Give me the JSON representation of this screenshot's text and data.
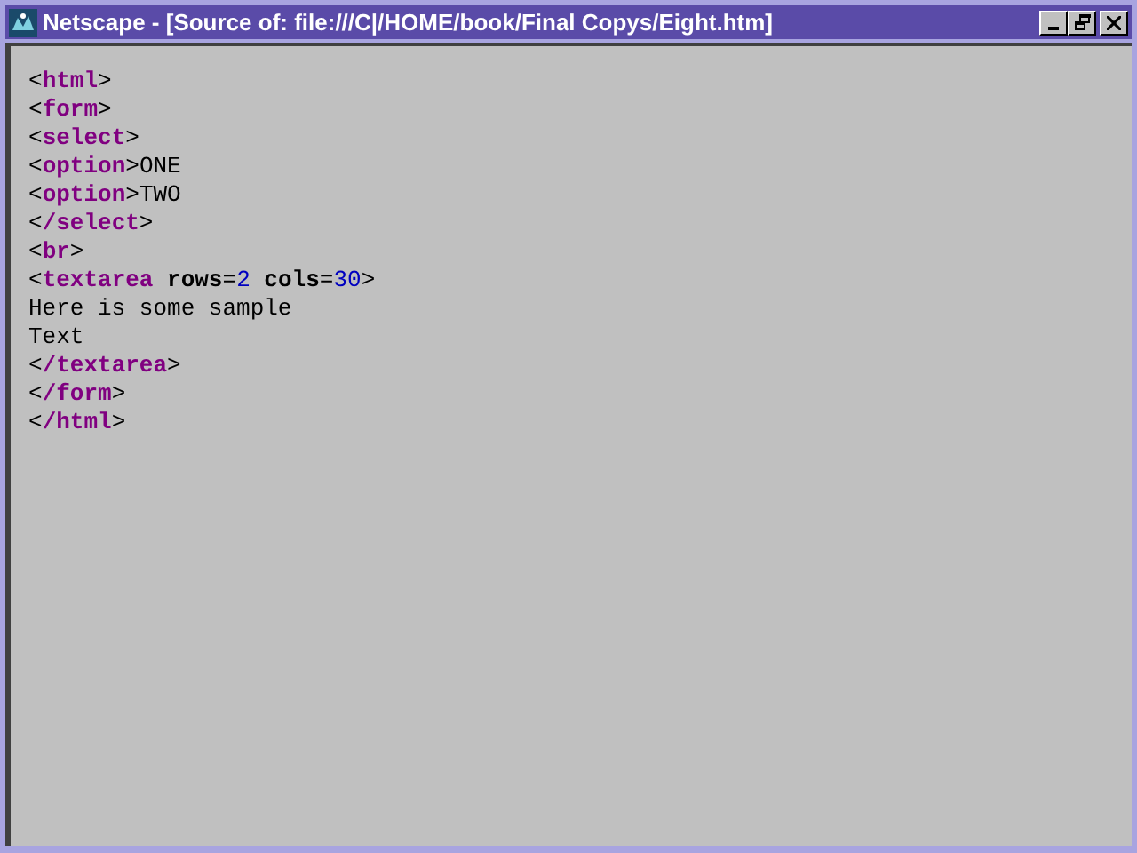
{
  "window": {
    "title": "Netscape - [Source of: file:///C|/HOME/book/Final Copys/Eight.htm]"
  },
  "source_lines": [
    [
      {
        "kind": "punct",
        "text": "<"
      },
      {
        "kind": "tag",
        "text": "html"
      },
      {
        "kind": "punct",
        "text": ">"
      }
    ],
    [
      {
        "kind": "punct",
        "text": "<"
      },
      {
        "kind": "tag",
        "text": "form"
      },
      {
        "kind": "punct",
        "text": ">"
      }
    ],
    [
      {
        "kind": "punct",
        "text": "<"
      },
      {
        "kind": "tag",
        "text": "select"
      },
      {
        "kind": "punct",
        "text": ">"
      }
    ],
    [
      {
        "kind": "punct",
        "text": "<"
      },
      {
        "kind": "tag",
        "text": "option"
      },
      {
        "kind": "punct",
        "text": ">"
      },
      {
        "kind": "text",
        "text": "ONE"
      }
    ],
    [
      {
        "kind": "punct",
        "text": "<"
      },
      {
        "kind": "tag",
        "text": "option"
      },
      {
        "kind": "punct",
        "text": ">"
      },
      {
        "kind": "text",
        "text": "TWO"
      }
    ],
    [
      {
        "kind": "punct",
        "text": "<"
      },
      {
        "kind": "tag",
        "text": "/select"
      },
      {
        "kind": "punct",
        "text": ">"
      }
    ],
    [
      {
        "kind": "punct",
        "text": "<"
      },
      {
        "kind": "tag",
        "text": "br"
      },
      {
        "kind": "punct",
        "text": ">"
      }
    ],
    [
      {
        "kind": "punct",
        "text": "<"
      },
      {
        "kind": "tag",
        "text": "textarea "
      },
      {
        "kind": "attr",
        "text": "rows"
      },
      {
        "kind": "punct",
        "text": "="
      },
      {
        "kind": "value",
        "text": "2"
      },
      {
        "kind": "attr",
        "text": " cols"
      },
      {
        "kind": "punct",
        "text": "="
      },
      {
        "kind": "value",
        "text": "30"
      },
      {
        "kind": "punct",
        "text": ">"
      }
    ],
    [
      {
        "kind": "text",
        "text": "Here is some sample"
      }
    ],
    [
      {
        "kind": "text",
        "text": "Text"
      }
    ],
    [
      {
        "kind": "punct",
        "text": "<"
      },
      {
        "kind": "tag",
        "text": "/textarea"
      },
      {
        "kind": "punct",
        "text": ">"
      }
    ],
    [
      {
        "kind": "punct",
        "text": "<"
      },
      {
        "kind": "tag",
        "text": "/form"
      },
      {
        "kind": "punct",
        "text": ">"
      }
    ],
    [
      {
        "kind": "punct",
        "text": "<"
      },
      {
        "kind": "tag",
        "text": "/html"
      },
      {
        "kind": "punct",
        "text": ">"
      }
    ]
  ]
}
